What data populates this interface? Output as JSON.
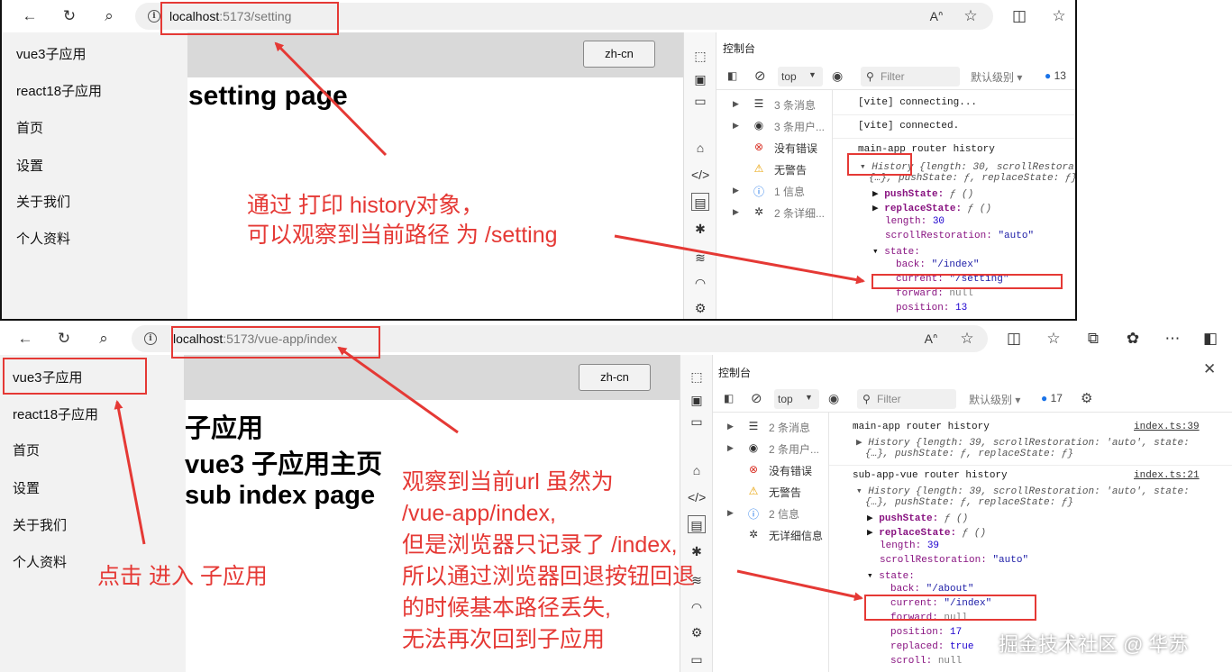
{
  "top": {
    "url_host": "localhost",
    "url_path": ":5173/setting",
    "lang_button": "zh-cn",
    "heading": "setting page",
    "sidebar": [
      "vue3子应用",
      "react18子应用",
      "首页",
      "设置",
      "关于我们",
      "个人资料"
    ],
    "devtools": {
      "title": "控制台",
      "context": "top",
      "filter_placeholder": "Filter",
      "level": "默认级别",
      "issues": "13",
      "side": [
        "3 条消息",
        "3 条用户...",
        "没有错误",
        "无警告",
        "1 信息",
        "2 条详细..."
      ],
      "lines": {
        "l1": "[vite] connecting...",
        "l2": "[vite] connected.",
        "l3": "main-app router history",
        "hist_name": "History",
        "hist_sum1": "{length: 30, scrollRestorat",
        "hist_sum2": "{…}, pushState: ƒ, replaceState: ƒ}",
        "push_key": "pushState:",
        "push_val": "ƒ ()",
        "replace_key": "replaceState:",
        "replace_val": "ƒ ()",
        "length_key": "length:",
        "length_val": "30",
        "scroll_key": "scrollRestoration:",
        "scroll_val": "\"auto\"",
        "state_key": "state:",
        "back_key": "back:",
        "back_val": "\"/index\"",
        "current_key": "current:",
        "current_val": "\"/setting\"",
        "forward_key": "forward:",
        "forward_val": "null",
        "position_key": "position:",
        "position_val": "13"
      }
    },
    "note": [
      "通过 打印 history对象，",
      "可以观察到当前路径 为 /setting"
    ]
  },
  "bottom": {
    "url_host": "localhost",
    "url_path": ":5173/vue-app/index",
    "lang_button": "zh-cn",
    "headings": [
      "子应用",
      "vue3 子应用主页",
      "sub index page"
    ],
    "sidebar": [
      "vue3子应用",
      "react18子应用",
      "首页",
      "设置",
      "关于我们",
      "个人资料"
    ],
    "devtools": {
      "title": "控制台",
      "context": "top",
      "filter_placeholder": "Filter",
      "level": "默认级别",
      "issues": "17",
      "side": [
        "2 条消息",
        "2 条用户...",
        "没有错误",
        "无警告",
        "2 信息",
        "无详细信息"
      ],
      "lines": {
        "g1": "main-app router history",
        "g1_link": "index.ts:39",
        "g1_sum1": "History {length: 39, scrollRestoration: 'auto', state:",
        "g1_sum2": "{…}, pushState: ƒ, replaceState: ƒ}",
        "g2": "sub-app-vue router history",
        "g2_link": "index.ts:21",
        "g2_sum1": "History {length: 39, scrollRestoration: 'auto', state:",
        "g2_sum2": "{…}, pushState: ƒ, replaceState: ƒ}",
        "push_key": "pushState:",
        "push_val": "ƒ ()",
        "replace_key": "replaceState:",
        "replace_val": "ƒ ()",
        "length_key": "length:",
        "length_val": "39",
        "scroll_key": "scrollRestoration:",
        "scroll_val": "\"auto\"",
        "state_key": "state:",
        "back_key": "back:",
        "back_val": "\"/about\"",
        "current_key": "current:",
        "current_val": "\"/index\"",
        "forward_key": "forward:",
        "forward_val": "null",
        "position_key": "position:",
        "position_val": "17",
        "replaced_key": "replaced:",
        "replaced_val": "true",
        "scroll2_key": "scroll:",
        "scroll2_val": "null"
      }
    },
    "note_click": "点击 进入 子应用",
    "note": [
      "观察到当前url 虽然为",
      "/vue-app/index,",
      "但是浏览器只记录了 /index,",
      "所以通过浏览器回退按钮回退",
      "的时候基本路径丢失,",
      "无法再次回到子应用"
    ],
    "watermark": "掘金技术社区 @ 华苏"
  },
  "icons": {
    "back": "back-arrow-icon",
    "refresh": "refresh-icon",
    "search": "search-icon",
    "info": "site-info-icon",
    "read_aloud": "read-aloud-icon",
    "favorite": "star-icon",
    "split": "split-screen-icon",
    "favorites": "favorites-icon",
    "collections": "collections-icon",
    "more": "more-icon",
    "sidebar": "sidebar-toggle-icon",
    "close": "close-icon",
    "color_accent": "#e53935"
  }
}
